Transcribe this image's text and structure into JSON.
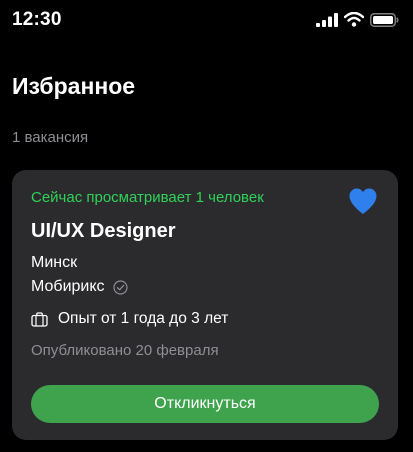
{
  "status_bar": {
    "time": "12:30",
    "icons": [
      "signal-icon",
      "wifi-icon",
      "battery-icon"
    ]
  },
  "header": {
    "title": "Избранное"
  },
  "summary": {
    "count_text": "1 вакансия"
  },
  "vacancy": {
    "viewing_now": "Сейчас просматривает 1 человек",
    "title": "UI/UX Designer",
    "city": "Минск",
    "company": "Мобирикс",
    "experience": "Опыт от 1 года до 3 лет",
    "published": "Опубликовано 20 февраля",
    "favorite": true,
    "apply_label": "Откликнуться"
  },
  "colors": {
    "background": "#000000",
    "card": "#2b2b2e",
    "accent_green": "#30d158",
    "button_green": "#3fa34d",
    "heart_blue": "#2f80ed",
    "muted_text": "#8e8e93"
  }
}
